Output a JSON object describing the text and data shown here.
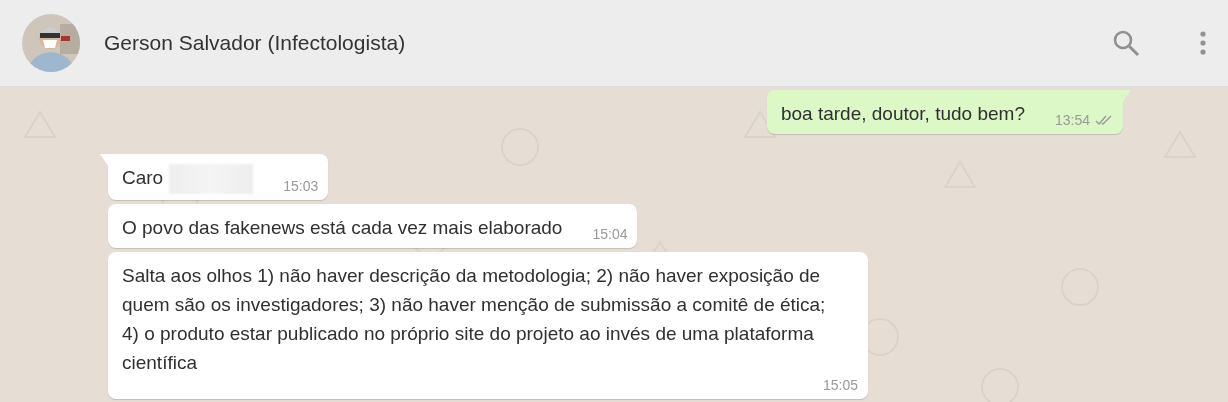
{
  "header": {
    "contact_name": "Gerson Salvador (Infectologista)"
  },
  "messages": [
    {
      "kind": "outgoing",
      "tail": true,
      "text": "boa tarde, doutor, tudo bem?",
      "time": "13:54",
      "read": false
    },
    {
      "kind": "incoming",
      "tail": true,
      "text": "Caro",
      "redacted": true,
      "time": "15:03"
    },
    {
      "kind": "incoming",
      "tail": false,
      "text": "O povo das fakenews está cada vez mais elaborado",
      "time": "15:04"
    },
    {
      "kind": "incoming",
      "tail": false,
      "text": "Salta aos olhos 1) não haver descrição da metodologia; 2) não haver exposição de quem são os investigadores; 3) não haver menção de submissão a comitê de ética; 4) o produto estar publicado no próprio site do projeto ao invés de uma plataforma científica",
      "time": "15:05"
    }
  ]
}
